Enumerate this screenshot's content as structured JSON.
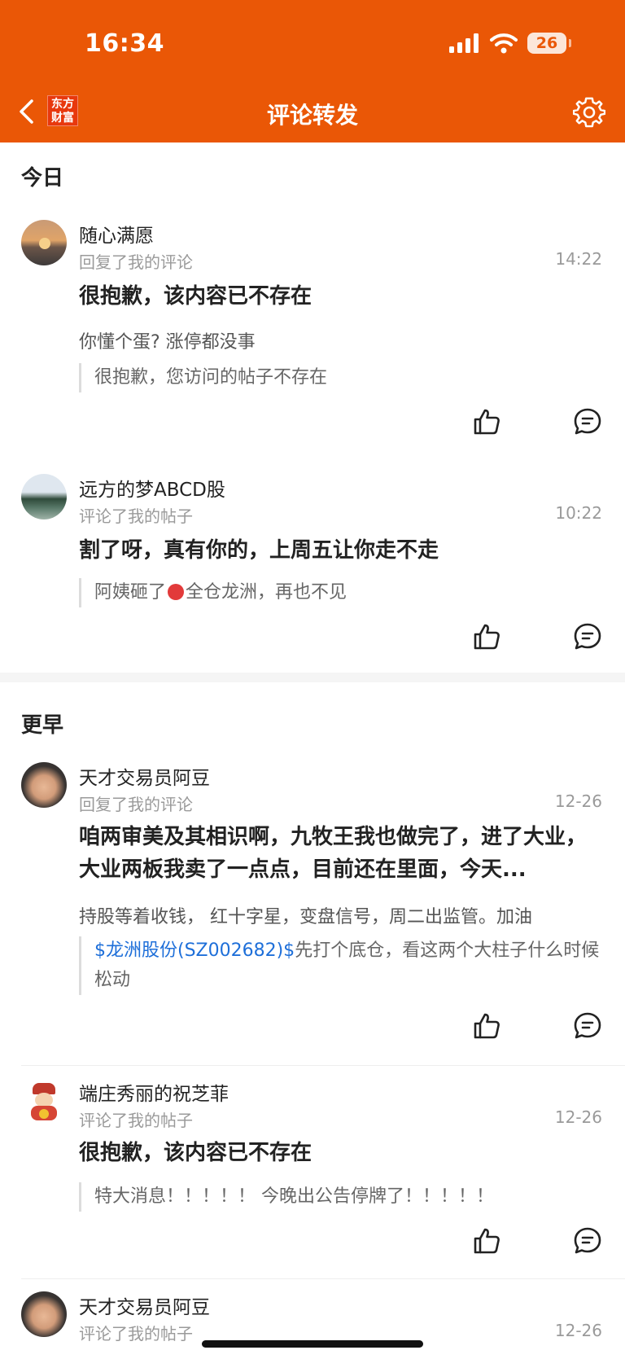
{
  "status_bar": {
    "time": "16:34",
    "battery": "26"
  },
  "nav": {
    "logo_line1": "东方",
    "logo_line2": "财富",
    "title": "评论转发"
  },
  "sections": [
    {
      "title": "今日",
      "items": [
        {
          "name": "随心满愿",
          "action": "回复了我的评论",
          "time": "14:22",
          "content": "很抱歉，该内容已不存在",
          "reply": "你懂个蛋?    涨停都没事",
          "quote": "很抱歉，您访问的帖子不存在"
        },
        {
          "name": "远方的梦ABCD股",
          "action": "评论了我的帖子",
          "time": "10:22",
          "content": "割了呀，真有你的，上周五让你走不走",
          "quote_before": "阿姨砸了",
          "quote_after": "全仓龙洲，再也不见"
        }
      ]
    },
    {
      "title": "更早",
      "items": [
        {
          "name": "天才交易员阿豆",
          "action": "回复了我的评论",
          "time": "12-26",
          "content": "咱两审美及其相识啊，九牧王我也做完了，进了大业，大业两板我卖了一点点，目前还在里面，今天...",
          "reply": "持股等着收钱，  红十字星，变盘信号，周二出监管。加油",
          "quote_link": "$龙洲股份(SZ002682)$",
          "quote": "先打个底仓，看这两个大柱子什么时候松动"
        },
        {
          "name": "端庄秀丽的祝芝菲",
          "action": "评论了我的帖子",
          "time": "12-26",
          "content": "很抱歉，该内容已不存在",
          "quote": "特大消息！！！！！ 今晚出公告停牌了！！！！！"
        },
        {
          "name": "天才交易员阿豆",
          "action": "评论了我的帖子",
          "time": "12-26"
        }
      ]
    }
  ],
  "colors": {
    "brand": "#EA5706",
    "link": "#1E6FD9",
    "muted": "#9a9a9a"
  }
}
